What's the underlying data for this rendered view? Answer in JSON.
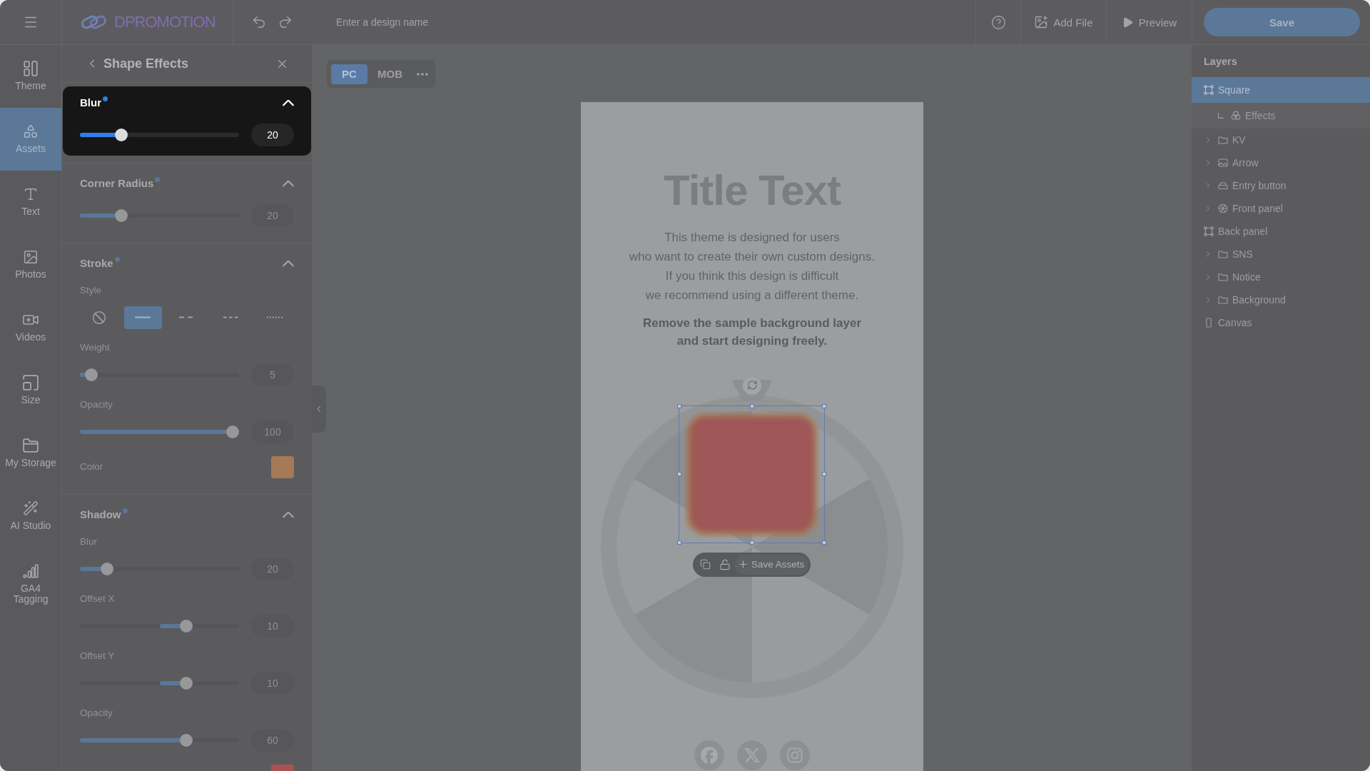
{
  "topbar": {
    "logo": "DPROMOTION",
    "design_name": {
      "placeholder": "Enter a design name"
    },
    "actions": [
      {
        "kind": "add-file",
        "label": "Add File"
      },
      {
        "kind": "preview",
        "label": "Preview"
      }
    ],
    "save_label": "Save"
  },
  "rail": [
    {
      "kind": "theme",
      "label": "Theme",
      "selected": false
    },
    {
      "kind": "assets",
      "label": "Assets",
      "selected": true
    },
    {
      "kind": "text",
      "label": "Text",
      "selected": false
    },
    {
      "kind": "photos",
      "label": "Photos",
      "selected": false
    },
    {
      "kind": "videos",
      "label": "Videos",
      "selected": false
    },
    {
      "kind": "size",
      "label": "Size",
      "selected": false
    },
    {
      "kind": "storage",
      "label": "My Storage",
      "selected": false
    },
    {
      "kind": "ai",
      "label": "AI Studio",
      "selected": false
    },
    {
      "kind": "ga4",
      "label": "GA4\nTagging",
      "selected": false
    }
  ],
  "panel": {
    "title": "Shape Effects",
    "sections": [
      {
        "title": "Blur",
        "active": true,
        "modified": true,
        "expanded": true,
        "rows": [
          {
            "kind": "slider",
            "level": 0.26,
            "reading": "20"
          }
        ]
      },
      {
        "title": "Corner Radius",
        "active": false,
        "modified": true,
        "expanded": true,
        "rows": [
          {
            "kind": "slider",
            "level": 0.26,
            "reading": "20"
          }
        ]
      },
      {
        "title": "Stroke",
        "active": false,
        "modified": true,
        "expanded": true,
        "rows": [
          {
            "kind": "styles",
            "label": "Style",
            "options": [
              {
                "kind": "none",
                "selected": false
              },
              {
                "kind": "solid",
                "selected": true
              },
              {
                "kind": "dashed",
                "selected": false
              },
              {
                "kind": "short-dashed",
                "selected": false
              },
              {
                "kind": "dotted",
                "selected": false
              }
            ]
          },
          {
            "kind": "slider",
            "label": "Weight",
            "level": 0.07,
            "reading": "5"
          },
          {
            "kind": "slider",
            "label": "Opacity",
            "level": 0.96,
            "reading": "100"
          },
          {
            "kind": "color",
            "label": "Color",
            "color": "#a67a56"
          }
        ]
      },
      {
        "title": "Shadow",
        "active": false,
        "modified": true,
        "expanded": true,
        "rows": [
          {
            "kind": "slider",
            "label": "Blur",
            "level": 0.17,
            "reading": "20"
          },
          {
            "kind": "centered-slider",
            "label": "Offset X",
            "level": 0.67,
            "reading": "10"
          },
          {
            "kind": "centered-slider",
            "label": "Offset Y",
            "level": 0.67,
            "reading": "10"
          },
          {
            "kind": "slider",
            "label": "Opacity",
            "level": 0.67,
            "reading": "60"
          },
          {
            "kind": "color",
            "color": "#a85252"
          }
        ]
      }
    ]
  },
  "canvas": {
    "views": [
      {
        "label": "PC",
        "selected": true
      },
      {
        "label": "MOB",
        "selected": false
      }
    ],
    "artboard": {
      "title": "Title Text",
      "body": "This theme is designed for users\nwho want to create their own custom designs.\nIf you think this design is difficult\nwe recommend using a different theme.",
      "note": "Remove the sample background layer\nand start designing freely.",
      "toolbar": {
        "save_label": "Save Assets"
      },
      "social": [
        {
          "kind": "facebook"
        },
        {
          "kind": "x"
        },
        {
          "kind": "instagram"
        }
      ]
    }
  },
  "layers": {
    "title": "Layers",
    "items": [
      {
        "name": "Square",
        "kind": "shape",
        "selected": true,
        "children": [
          {
            "name": "Effects",
            "kind": "effects",
            "selected": false
          }
        ]
      },
      {
        "name": "KV",
        "kind": "folder",
        "selected": false,
        "expanded": false
      },
      {
        "name": "Arrow",
        "kind": "image",
        "selected": false,
        "expanded": false
      },
      {
        "name": "Entry button",
        "kind": "button",
        "selected": false,
        "expanded": false
      },
      {
        "name": "Front panel",
        "kind": "wheel",
        "selected": false,
        "expanded": false
      },
      {
        "name": "Back panel",
        "kind": "shape",
        "selected": false
      },
      {
        "name": "SNS",
        "kind": "folder",
        "selected": false,
        "expanded": false
      },
      {
        "name": "Notice",
        "kind": "folder",
        "selected": false,
        "expanded": false
      },
      {
        "name": "Background",
        "kind": "folder",
        "selected": false,
        "expanded": false
      },
      {
        "name": "Canvas",
        "kind": "canvas",
        "selected": false
      }
    ]
  }
}
